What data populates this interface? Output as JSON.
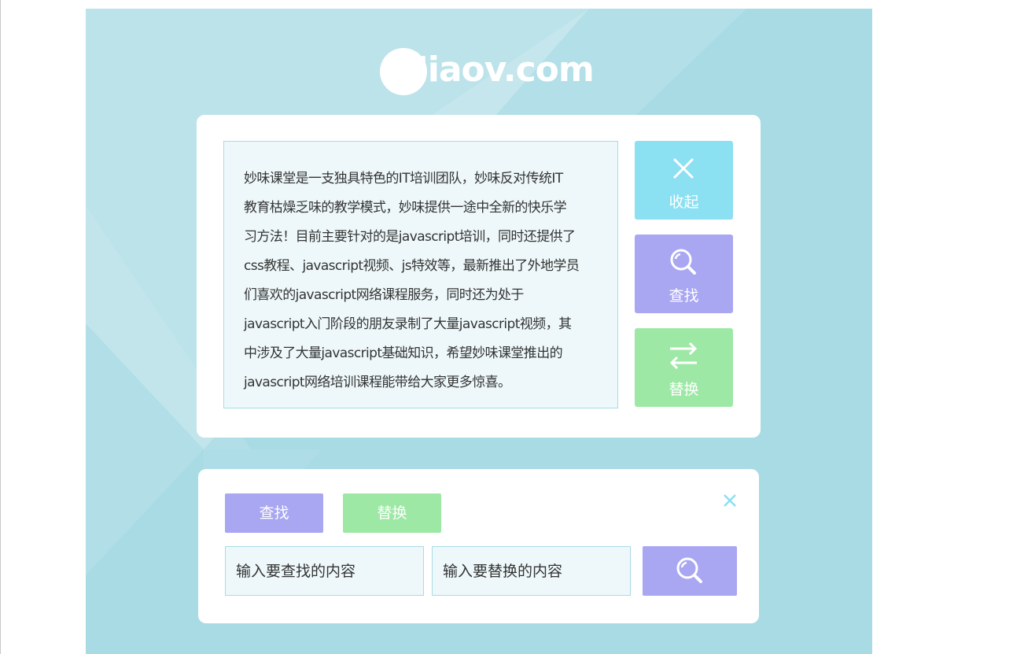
{
  "logo": {
    "text": "Miaov.com"
  },
  "article": {
    "lines": [
      "妙味课堂是一支独具特色的IT培训团队，妙味反对传统IT",
      "教育枯燥乏味的教学模式，妙味提供一途中全新的快乐学",
      "习方法！目前主要针对的是javascript培训，同时还提供了",
      "css教程、javascript视频、js特效等，最新推出了外地学员",
      "们喜欢的javascript网络课程服务，同时还为处于",
      "javascript入门阶段的朋友录制了大量javascript视频，其",
      "中涉及了大量javascript基础知识，希望妙味课堂推出的",
      "javascript网络培训课程能带给大家更多惊喜。"
    ]
  },
  "side_buttons": {
    "collapse": {
      "label": "收起",
      "icon": "close-icon"
    },
    "find": {
      "label": "查找",
      "icon": "search-icon"
    },
    "replace": {
      "label": "替换",
      "icon": "swap-arrows-icon"
    }
  },
  "panel": {
    "tabs": {
      "find": "查找",
      "replace": "替换"
    },
    "close_icon": "close-icon",
    "find_input": {
      "placeholder": "输入要查找的内容",
      "value": ""
    },
    "replace_input": {
      "placeholder": "输入要替换的内容",
      "value": ""
    },
    "submit_icon": "search-icon"
  },
  "colors": {
    "background": "#a9dbe5",
    "collapse": "#8be0f2",
    "find": "#a9a6f2",
    "replace": "#9ee8a6",
    "field_bg": "#eef8fa",
    "field_border": "#a8dbe6"
  }
}
